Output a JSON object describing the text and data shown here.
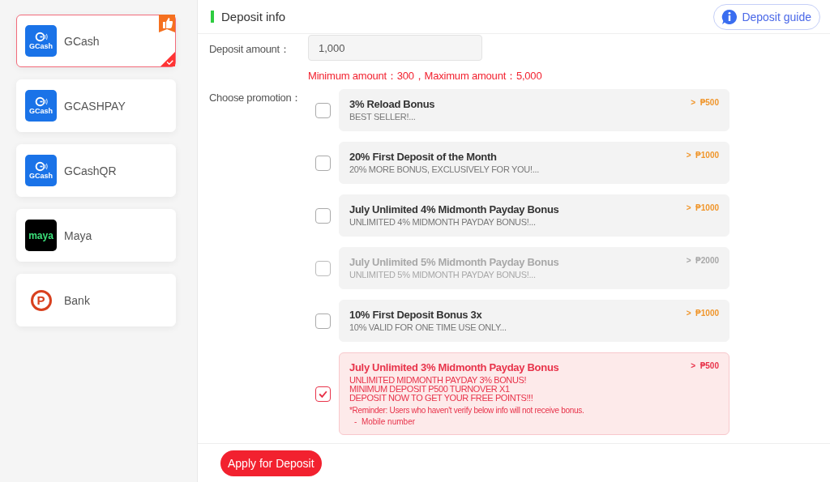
{
  "methods": [
    {
      "name": "GCash",
      "kind": "gcash",
      "logo_text": "GCash",
      "selected": true,
      "recommended": true
    },
    {
      "name": "GCASHPAY",
      "kind": "gcash",
      "logo_text": "GCash",
      "selected": false,
      "recommended": false
    },
    {
      "name": "GCashQR",
      "kind": "gcash",
      "logo_text": "GCash",
      "selected": false,
      "recommended": false
    },
    {
      "name": "Maya",
      "kind": "maya",
      "logo_text": "maya",
      "selected": false,
      "recommended": false
    },
    {
      "name": "Bank",
      "kind": "bank",
      "logo_text": "P",
      "selected": false,
      "recommended": false
    }
  ],
  "header": {
    "title": "Deposit info",
    "guide_button": "Deposit guide"
  },
  "amount": {
    "label": "Deposit amount：",
    "value": "1,000",
    "limits": "Minimum amount：300，Maximum amount：5,000"
  },
  "promotion_label": "Choose promotion：",
  "promotions": [
    {
      "title": "3% Reload Bonus",
      "summary": "BEST SELLER!...",
      "min": ">  ₱500",
      "selected": false,
      "disabled": false
    },
    {
      "title": "20% First Deposit of the Month",
      "summary": "20% MORE BONUS, EXCLUSIVELY FOR YOU!...",
      "min": ">  ₱1000",
      "selected": false,
      "disabled": false
    },
    {
      "title": "July Unlimited 4% Midmonth Payday Bonus",
      "summary": "UNLIMITED 4% MIDMONTH PAYDAY BONUS!...",
      "min": ">  ₱1000",
      "selected": false,
      "disabled": false
    },
    {
      "title": "July Unlimited 5% Midmonth Payday Bonus",
      "summary": "UNLIMITED 5% MIDMONTH PAYDAY BONUS!...",
      "min": ">  ₱2000",
      "selected": false,
      "disabled": true
    },
    {
      "title": "10% First Deposit Bonus 3x",
      "summary": "10% VALID FOR ONE TIME USE ONLY...",
      "min": ">  ₱1000",
      "selected": false,
      "disabled": false
    },
    {
      "title": "July Unlimited 3% Midmonth Payday Bonus",
      "details": [
        "UNLIMITED MIDMONTH PAYDAY 3% BONUS!",
        "MINIMUM DEPOSIT P500 TURNOVER X1",
        "DEPOSIT NOW TO GET YOUR FREE POINTS!!!"
      ],
      "reminder": "*Reminder: Users who haven't verify below info will not receive bonus.",
      "requirements": [
        "-  Mobile number"
      ],
      "min": ">  ₱500",
      "selected": true,
      "disabled": false
    }
  ],
  "submit_button": "Apply for Deposit"
}
